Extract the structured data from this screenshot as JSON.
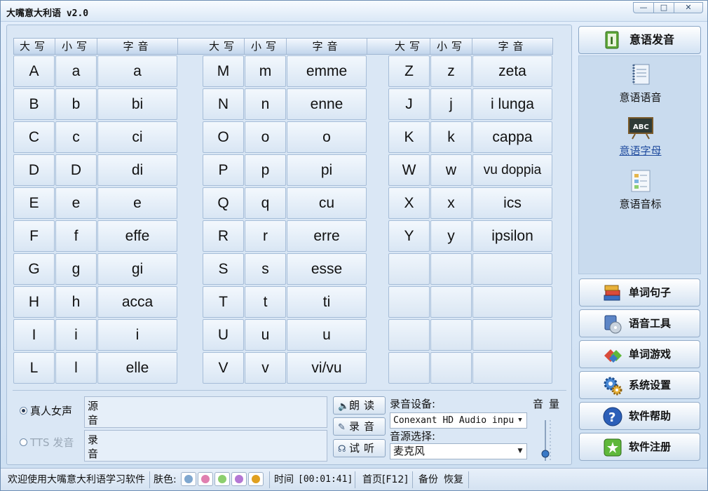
{
  "window": {
    "title": "大嘴意大利语 v2.0"
  },
  "table": {
    "headers": [
      "大写",
      "小写",
      "字音"
    ],
    "columns": [
      [
        {
          "upper": "A",
          "lower": "a",
          "sound": "a"
        },
        {
          "upper": "B",
          "lower": "b",
          "sound": "bi"
        },
        {
          "upper": "C",
          "lower": "c",
          "sound": "ci"
        },
        {
          "upper": "D",
          "lower": "D",
          "sound": "di"
        },
        {
          "upper": "E",
          "lower": "e",
          "sound": "e"
        },
        {
          "upper": "F",
          "lower": "f",
          "sound": "effe"
        },
        {
          "upper": "G",
          "lower": "g",
          "sound": "gi"
        },
        {
          "upper": "H",
          "lower": "h",
          "sound": "acca"
        },
        {
          "upper": "I",
          "lower": "i",
          "sound": "i"
        },
        {
          "upper": "L",
          "lower": "l",
          "sound": "elle"
        }
      ],
      [
        {
          "upper": "M",
          "lower": "m",
          "sound": "emme"
        },
        {
          "upper": "N",
          "lower": "n",
          "sound": "enne"
        },
        {
          "upper": "O",
          "lower": "o",
          "sound": "o"
        },
        {
          "upper": "P",
          "lower": "p",
          "sound": "pi"
        },
        {
          "upper": "Q",
          "lower": "q",
          "sound": "cu"
        },
        {
          "upper": "R",
          "lower": "r",
          "sound": "erre"
        },
        {
          "upper": "S",
          "lower": "s",
          "sound": "esse"
        },
        {
          "upper": "T",
          "lower": "t",
          "sound": "ti"
        },
        {
          "upper": "U",
          "lower": "u",
          "sound": "u"
        },
        {
          "upper": "V",
          "lower": "v",
          "sound": "vi/vu"
        }
      ],
      [
        {
          "upper": "Z",
          "lower": "z",
          "sound": "zeta"
        },
        {
          "upper": "J",
          "lower": "j",
          "sound": "i lunga"
        },
        {
          "upper": "K",
          "lower": "k",
          "sound": "cappa"
        },
        {
          "upper": "W",
          "lower": "w",
          "sound": "vu doppia"
        },
        {
          "upper": "X",
          "lower": "x",
          "sound": "ics"
        },
        {
          "upper": "Y",
          "lower": "y",
          "sound": "ipsilon"
        },
        {
          "upper": "",
          "lower": "",
          "sound": ""
        },
        {
          "upper": "",
          "lower": "",
          "sound": ""
        },
        {
          "upper": "",
          "lower": "",
          "sound": ""
        },
        {
          "upper": "",
          "lower": "",
          "sound": ""
        }
      ]
    ]
  },
  "voice": {
    "real_female": "真人女声",
    "tts": "TTS 发音",
    "source_label": "源音",
    "record_label": "录音"
  },
  "actions": {
    "read": "朗读",
    "record": "录音",
    "listen": "试听"
  },
  "device": {
    "device_label": "录音设备:",
    "device_value": "Conexant HD Audio input",
    "source_label": "音源选择:",
    "source_value": "麦克风",
    "volume_label": "音量"
  },
  "sidebar": {
    "header": "意语发音",
    "sub_items": [
      "意语语音",
      "意语字母",
      "意语音标"
    ],
    "active_sub": "意语字母",
    "nav": [
      "单词句子",
      "语音工具",
      "单词游戏",
      "系统设置",
      "软件帮助",
      "软件注册"
    ]
  },
  "status": {
    "welcome": "欢迎使用大嘴意大利语学习软件",
    "skin_label": "肤色:",
    "skin_colors": [
      "#7fa7cf",
      "#e07fb0",
      "#8ccf6e",
      "#b477d4",
      "#e0a020"
    ],
    "time_label": "时间",
    "time_value": "[00:01:41]",
    "home": "首页[F12]",
    "backup": "备份",
    "restore": "恢复"
  }
}
